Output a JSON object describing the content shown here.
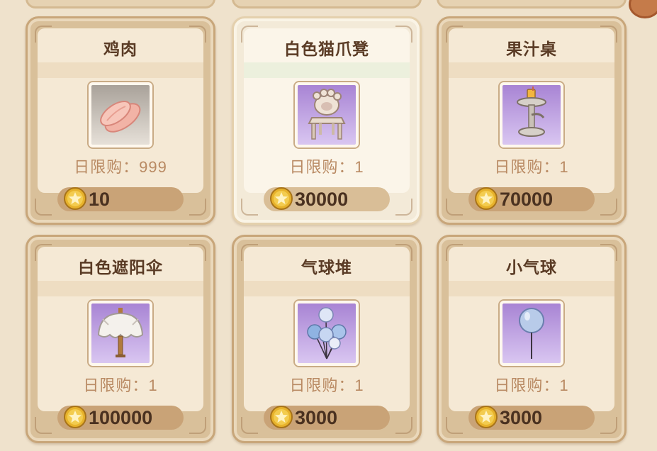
{
  "colors": {
    "gold": "#e7b22b",
    "tile_purple": "#b393df",
    "name_text": "#5a3b25"
  },
  "icons": {
    "currency": "gold-star-coin-icon"
  },
  "shop_items": [
    {
      "name": "鸡肉",
      "limit": "日限购：999",
      "price": "10",
      "icon": "chicken-meat-icon",
      "selected": false
    },
    {
      "name": "白色猫爪凳",
      "limit": "日限购：1",
      "price": "30000",
      "icon": "cat-paw-stool-icon",
      "selected": true
    },
    {
      "name": "果汁桌",
      "limit": "日限购：1",
      "price": "70000",
      "icon": "juice-table-icon",
      "selected": false
    },
    {
      "name": "白色遮阳伞",
      "limit": "日限购：1",
      "price": "100000",
      "icon": "white-parasol-icon",
      "selected": false
    },
    {
      "name": "气球堆",
      "limit": "日限购：1",
      "price": "3000",
      "icon": "balloon-pile-icon",
      "selected": false
    },
    {
      "name": "小气球",
      "limit": "日限购：1",
      "price": "3000",
      "icon": "small-balloon-icon",
      "selected": false
    }
  ]
}
